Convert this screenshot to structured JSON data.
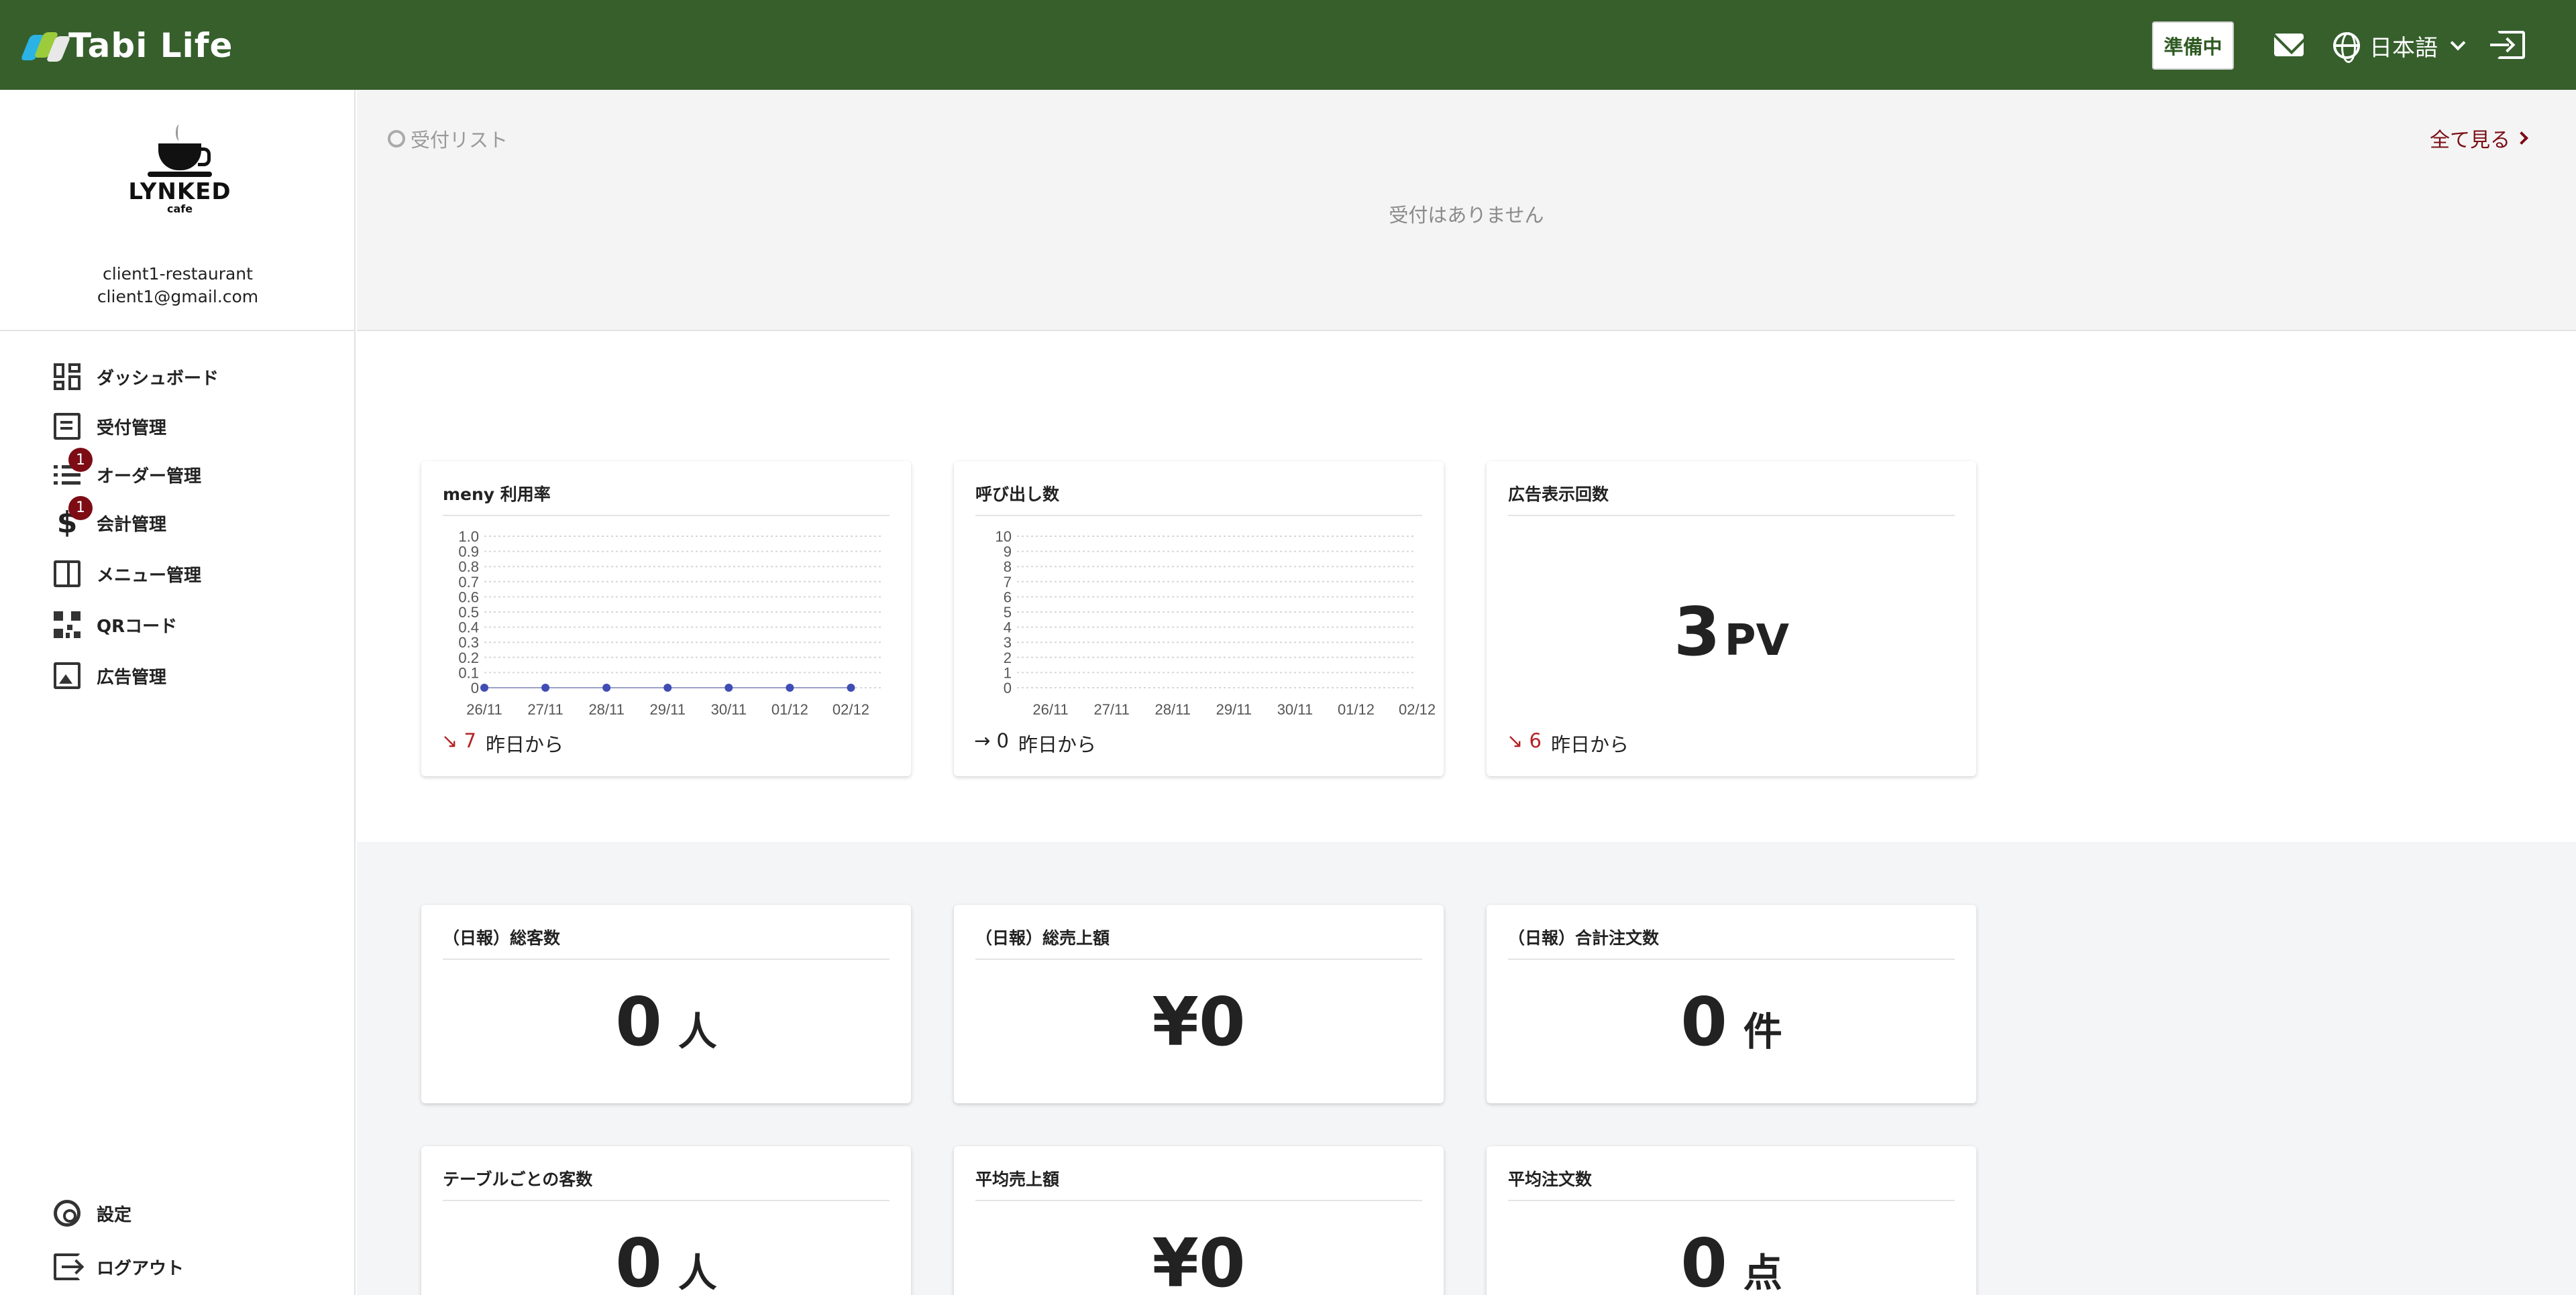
{
  "app": {
    "name": "Tabi Life"
  },
  "header": {
    "status_label": "準備中",
    "language": "日本語"
  },
  "sidebar": {
    "brand": {
      "name": "LYNKED",
      "sub": "cafe"
    },
    "client_name": "client1-restaurant",
    "client_email": "client1@gmail.com",
    "items": [
      {
        "label": "ダッシュボード",
        "icon": "dashboard-icon"
      },
      {
        "label": "受付管理",
        "icon": "reception-icon"
      },
      {
        "label": "オーダー管理",
        "icon": "list-icon",
        "badge": "1"
      },
      {
        "label": "会計管理",
        "icon": "dollar-icon",
        "badge": "1"
      },
      {
        "label": "メニュー管理",
        "icon": "menu-book-icon"
      },
      {
        "label": "QRコード",
        "icon": "qr-code-icon"
      },
      {
        "label": "広告管理",
        "icon": "ad-image-icon"
      }
    ],
    "bottom_items": [
      {
        "label": "設定",
        "icon": "gear-icon"
      },
      {
        "label": "ログアウト",
        "icon": "logout-icon"
      }
    ]
  },
  "reception": {
    "title": "受付リスト",
    "empty_text": "受付はありません",
    "see_all": "全て見る"
  },
  "stats": {
    "meny_rate": {
      "title": "meny 利用率",
      "delta": "↘ 7",
      "delta_label": "昨日から"
    },
    "calls": {
      "title": "呼び出し数",
      "delta": "→ 0",
      "delta_label": "昨日から"
    },
    "ad_views": {
      "title": "広告表示回数",
      "value": "3",
      "unit": "PV",
      "delta": "↘ 6",
      "delta_label": "昨日から"
    }
  },
  "daily": {
    "customers": {
      "title": "（日報）総客数",
      "value": "0",
      "unit": "人"
    },
    "sales": {
      "title": "（日報）総売上額",
      "value": "¥0",
      "unit": ""
    },
    "orders": {
      "title": "（日報）合計注文数",
      "value": "0",
      "unit": "件"
    },
    "per_table": {
      "title": "テーブルごとの客数",
      "value": "0",
      "unit": "人"
    },
    "avg_sales": {
      "title": "平均売上額",
      "value": "¥0",
      "unit": ""
    },
    "avg_orders": {
      "title": "平均注文数",
      "value": "0",
      "unit": "点"
    }
  },
  "chart_data": [
    {
      "type": "line",
      "title": "meny 利用率",
      "categories": [
        "26/11",
        "27/11",
        "28/11",
        "29/11",
        "30/11",
        "01/12",
        "02/12"
      ],
      "y_ticks": [
        "0",
        "0.1",
        "0.2",
        "0.3",
        "0.4",
        "0.5",
        "0.6",
        "0.7",
        "0.8",
        "0.9",
        "1.0"
      ],
      "values": [
        0,
        0,
        0,
        0,
        0,
        0,
        0
      ],
      "ylim": [
        0,
        1.0
      ],
      "grid": true,
      "show_points": true,
      "point_color": "#3f4db5"
    },
    {
      "type": "line",
      "title": "呼び出し数",
      "categories": [
        "26/11",
        "27/11",
        "28/11",
        "29/11",
        "30/11",
        "01/12",
        "02/12"
      ],
      "y_ticks": [
        "0",
        "1",
        "2",
        "3",
        "4",
        "5",
        "6",
        "7",
        "8",
        "9",
        "10"
      ],
      "values": [],
      "ylim": [
        0,
        10
      ],
      "grid": true,
      "show_points": false
    }
  ],
  "colors": {
    "header_bg": "#365f2c",
    "accent_red": "#7a0c14",
    "delta_down": "#b32424"
  }
}
